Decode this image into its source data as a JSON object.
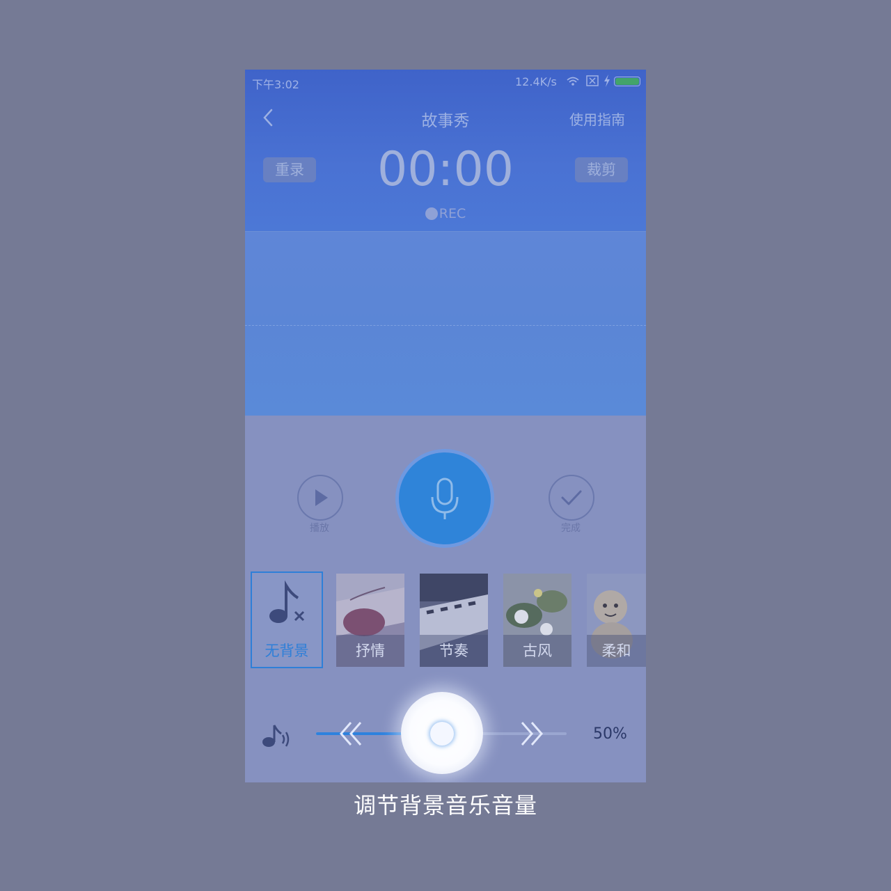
{
  "status": {
    "time": "下午3:02",
    "speed": "12.4K/s"
  },
  "header": {
    "title": "故事秀",
    "guide": "使用指南",
    "rerecord": "重录",
    "trim": "裁剪",
    "timer": "00:00",
    "rec_label": "REC"
  },
  "controls": {
    "play_label": "播放",
    "done_label": "完成"
  },
  "music": {
    "items": [
      {
        "label": "无背景",
        "selected": true
      },
      {
        "label": "抒情"
      },
      {
        "label": "节奏"
      },
      {
        "label": "古风"
      },
      {
        "label": "柔和"
      }
    ]
  },
  "volume": {
    "percent_label": "50%",
    "level": 0.5
  },
  "caption": "调节背景音乐音量",
  "colors": {
    "accent": "#2e82de",
    "overlay": "#757a95"
  }
}
